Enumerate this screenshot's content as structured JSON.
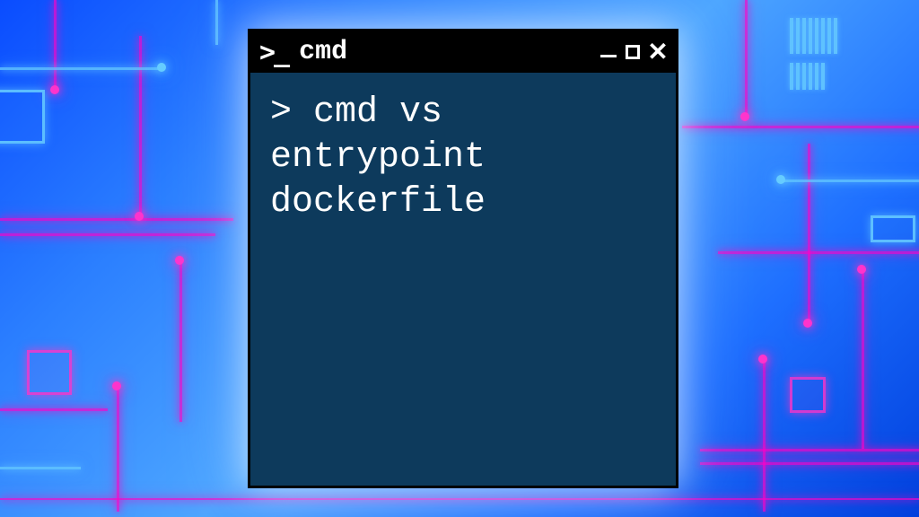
{
  "window": {
    "title": "cmd",
    "prompt_icon": ">_"
  },
  "terminal": {
    "prompt": "> ",
    "content": "cmd vs entrypoint dockerfile"
  },
  "colors": {
    "terminal_bg": "#0d3a5c",
    "titlebar_bg": "#000000",
    "text": "#ffffff",
    "neon_pink": "#ff33cc",
    "neon_blue": "#66ccff"
  }
}
